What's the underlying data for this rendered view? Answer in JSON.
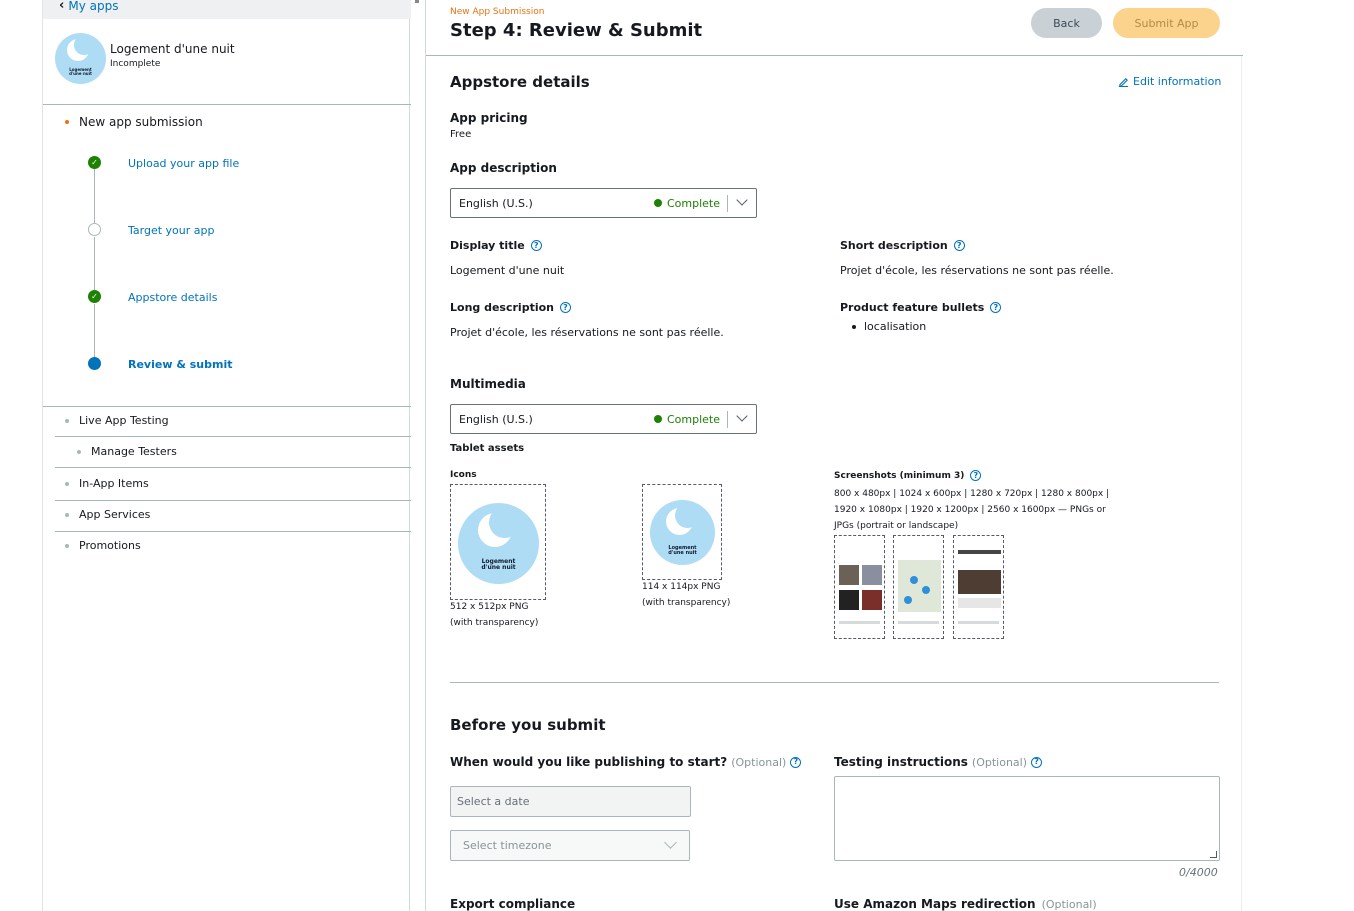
{
  "sidebar": {
    "back_link": "My apps",
    "app": {
      "name": "Logement d'une nuit",
      "status": "Incomplete",
      "logo_text": "Logement d'une nuit"
    },
    "submission_heading": "New app submission",
    "steps": [
      {
        "label": "Upload your app file",
        "state": "complete"
      },
      {
        "label": "Target your app",
        "state": "incomplete"
      },
      {
        "label": "Appstore details",
        "state": "complete"
      },
      {
        "label": "Review & submit",
        "state": "current"
      }
    ],
    "items": [
      {
        "label": "Live App Testing"
      },
      {
        "label": "Manage Testers"
      },
      {
        "label": "In-App Items"
      },
      {
        "label": "App Services"
      },
      {
        "label": "Promotions"
      }
    ]
  },
  "header": {
    "kicker": "New App Submission",
    "title": "Step 4: Review & Submit",
    "back_label": "Back",
    "submit_label": "Submit App"
  },
  "appstore": {
    "title": "Appstore details",
    "edit_label": "Edit information",
    "pricing_label": "App pricing",
    "pricing_value": "Free",
    "description_label": "App description",
    "language_select": {
      "language": "English (U.S.)",
      "status": "Complete"
    },
    "display_title_label": "Display title",
    "display_title_value": "Logement d'une nuit",
    "short_desc_label": "Short description",
    "short_desc_value": "Projet d'école, les réservations ne sont pas réelle.",
    "long_desc_label": "Long description",
    "long_desc_value": "Projet d'école, les réservations ne sont pas réelle.",
    "bullets_label": "Product feature bullets",
    "bullets": [
      "localisation"
    ]
  },
  "multimedia": {
    "title": "Multimedia",
    "language_select": {
      "language": "English (U.S.)",
      "status": "Complete"
    },
    "tablet_assets_label": "Tablet assets",
    "icons_label": "Icons",
    "icon_large_caption_1": "512 x 512px PNG",
    "icon_large_caption_2": "(with transparency)",
    "icon_small_caption_1": "114 x 114px PNG",
    "icon_small_caption_2": "(with transparency)",
    "screenshots_label": "Screenshots (minimum 3)",
    "screenshots_spec_1": "800 x 480px | 1024 x 600px | 1280 x 720px | 1280 x 800px |",
    "screenshots_spec_2": "1920 x 1080px | 1920 x 1200px | 2560 x 1600px — PNGs or",
    "screenshots_spec_3": "JPGs (portrait or landscape)",
    "screenshot_count": 3
  },
  "before_submit": {
    "title": "Before you submit",
    "publish_label": "When would you like publishing to start?",
    "optional": "(Optional)",
    "date_placeholder": "Select a date",
    "timezone_placeholder": "Select timezone",
    "testing_label": "Testing instructions",
    "char_count": "0/4000",
    "export_label": "Export compliance",
    "maps_label": "Use Amazon Maps redirection"
  },
  "colors": {
    "link": "#0073bb",
    "complete": "#1d8102",
    "accent_orange": "#ec7211",
    "logo_bg": "#aedcf5"
  }
}
